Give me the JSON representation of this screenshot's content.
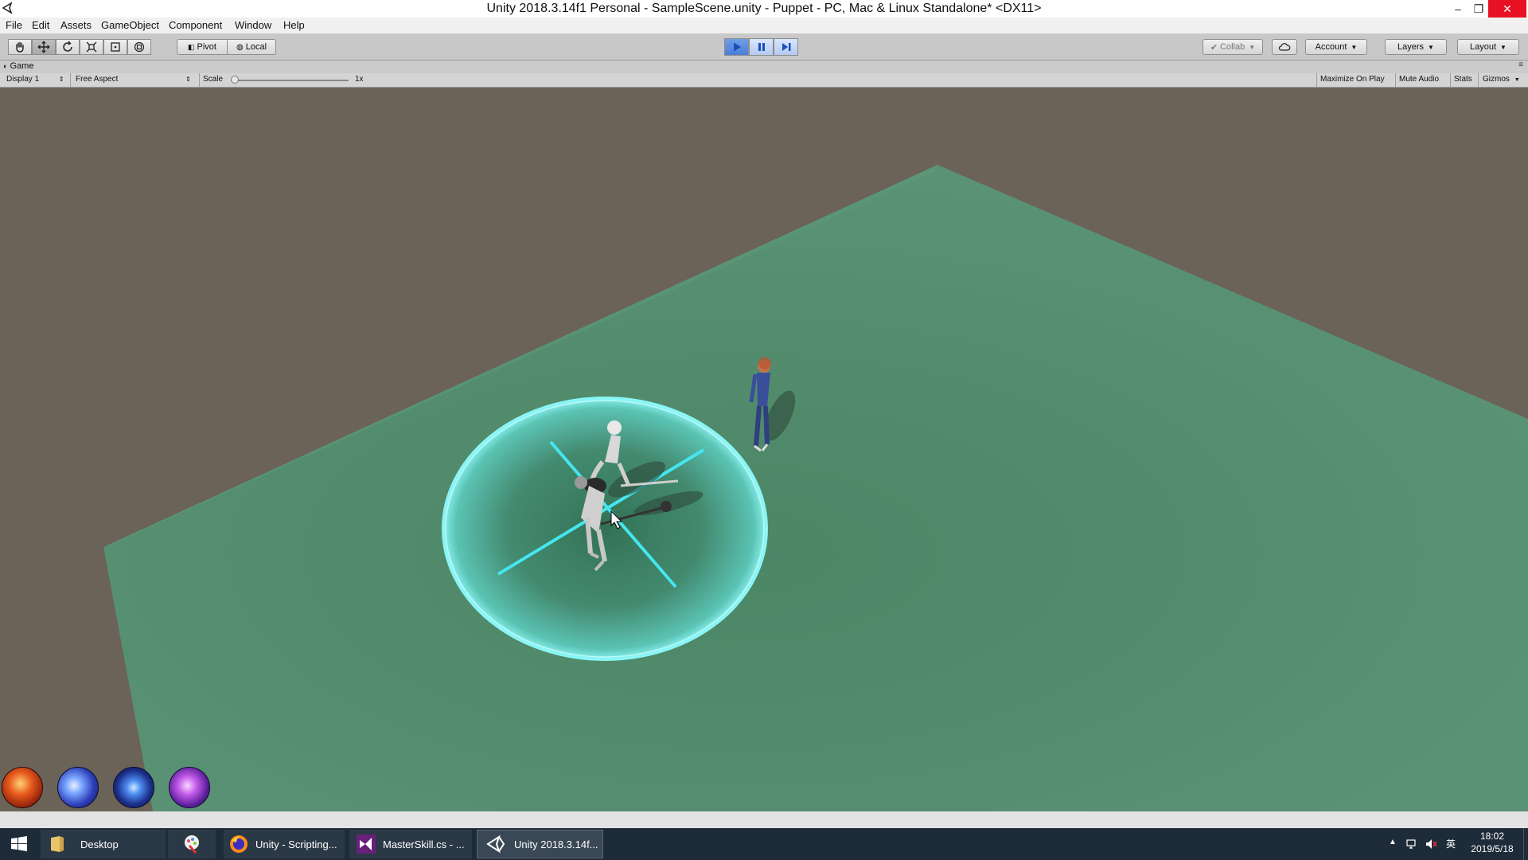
{
  "window": {
    "title": "Unity 2018.3.14f1 Personal - SampleScene.unity - Puppet - PC, Mac & Linux Standalone* <DX11>",
    "minimize": "–",
    "restore": "❐",
    "close": "✕"
  },
  "menu": {
    "items": [
      "File",
      "Edit",
      "Assets",
      "GameObject",
      "Component",
      "Window",
      "Help"
    ]
  },
  "toolbar": {
    "tools": [
      "hand-tool",
      "move-tool",
      "rotate-tool",
      "scale-tool",
      "rect-tool",
      "transform-tool"
    ],
    "active_tool": "move-tool",
    "pivot_label": "Pivot",
    "local_label": "Local",
    "play_state": "playing",
    "collab_label": "Collab",
    "account_label": "Account",
    "layers_label": "Layers",
    "layout_label": "Layout"
  },
  "game_view": {
    "tab_label": "Game",
    "display_label": "Display 1",
    "aspect_label": "Free Aspect",
    "scale_label": "Scale",
    "scale_value": "1x",
    "scale_slider_fraction": 0.0,
    "maximize_label": "Maximize On Play",
    "mute_label": "Mute Audio",
    "stats_label": "Stats",
    "gizmos_label": "Gizmos"
  },
  "scene": {
    "ground_color": "#4f8a68",
    "background_color": "#6b6258",
    "ring_color": "#54f0f0",
    "skill_icons": [
      "fire-skill-icon",
      "wind-skill-icon",
      "wave-skill-icon",
      "arcane-skill-icon"
    ]
  },
  "taskbar": {
    "start_icon": "windows-start-icon",
    "desktop_label": "Desktop",
    "firefox_label": "Unity - Scripting...",
    "vs_label": "MasterSkill.cs - ...",
    "unity_label": "Unity 2018.3.14f...",
    "ime_label": "英",
    "time": "18:02",
    "date": "2019/5/18"
  }
}
